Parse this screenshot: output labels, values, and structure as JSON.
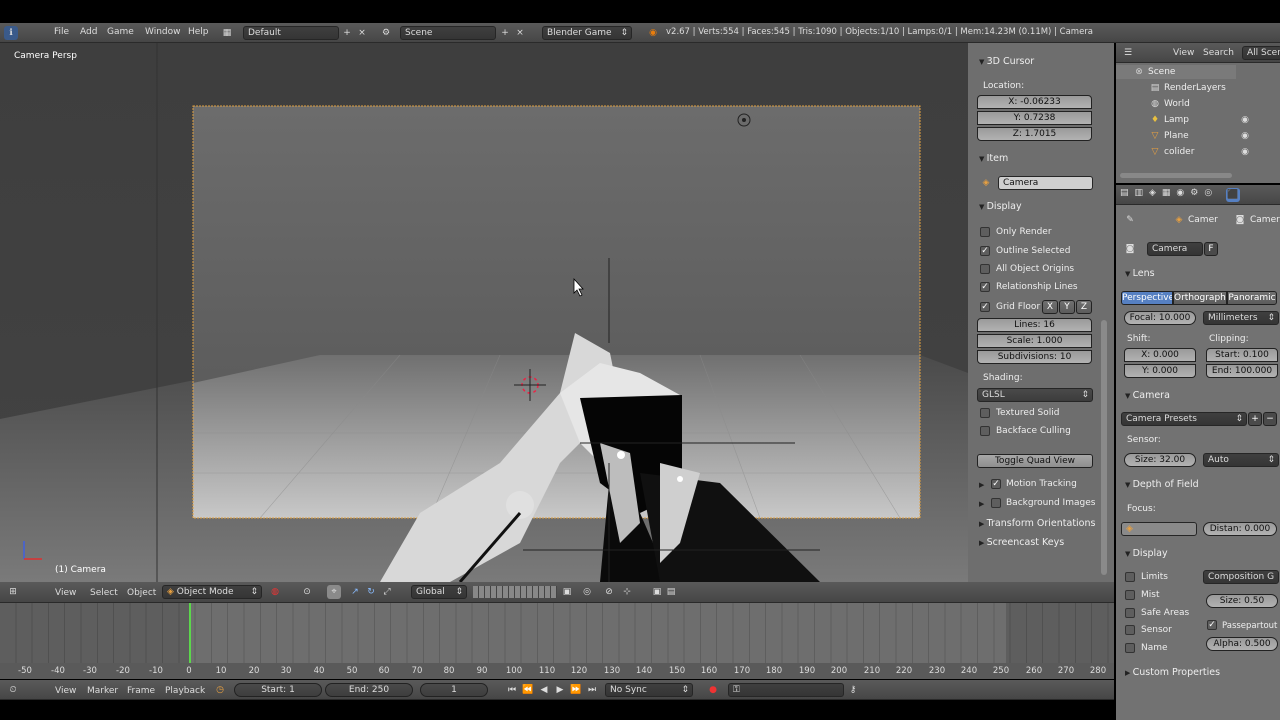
{
  "top_bar": {
    "menus": [
      "File",
      "Add",
      "Game",
      "Window",
      "Help"
    ],
    "layout_screen": "Default",
    "scene": "Scene",
    "engine": "Blender Game",
    "stats": "v2.67 | Verts:554 | Faces:545 | Tris:1090 | Objects:1/10 | Lamps:0/1 | Mem:14.23M (0.11M) | Camera"
  },
  "viewport": {
    "view_name": "Camera Persp",
    "object_label": "(1) Camera"
  },
  "properties_panel": {
    "cursor_header": "3D Cursor",
    "location_label": "Location:",
    "cursor_x": "X: -0.06233",
    "cursor_y": "Y: 0.7238",
    "cursor_z": "Z: 1.7015",
    "item_header": "Item",
    "item_name": "Camera",
    "display_header": "Display",
    "only_render": "Only Render",
    "outline_selected": "Outline Selected",
    "all_object_origins": "All Object Origins",
    "relationship_lines": "Relationship Lines",
    "grid_floor": "Grid Floor",
    "axis_x": "X",
    "axis_y": "Y",
    "axis_z": "Z",
    "lines": "Lines: 16",
    "scale": "Scale: 1.000",
    "subdivisions": "Subdivisions: 10",
    "shading_label": "Shading:",
    "shading_value": "GLSL",
    "textured_solid": "Textured Solid",
    "backface_culling": "Backface Culling",
    "toggle_quad_view": "Toggle Quad View",
    "motion_tracking": "Motion Tracking",
    "background_images": "Background Images",
    "transform_orientations": "Transform Orientations",
    "screencast_keys": "Screencast Keys"
  },
  "outliner": {
    "view": "View",
    "search": "Search",
    "all_scenes": "All Scen",
    "items": [
      "Scene",
      "RenderLayers",
      "World",
      "Lamp",
      "Plane",
      "colider"
    ]
  },
  "camera_props": {
    "breadcrumb_1": "Camer",
    "breadcrumb_2": "Camer",
    "datablock": "Camera",
    "fake_user": "F",
    "lens_header": "Lens",
    "tab_perspective": "Perspective",
    "tab_orthographic": "Orthographic",
    "tab_panoramic": "Panoramic",
    "focal": "Focal: 10.000",
    "units": "Millimeters",
    "shift_label": "Shift:",
    "clipping_label": "Clipping:",
    "shift_x": "X: 0.000",
    "shift_y": "Y: 0.000",
    "clip_start": "Start: 0.100",
    "clip_end": "End: 100.000",
    "camera_header": "Camera",
    "camera_presets": "Camera Presets",
    "sensor_label": "Sensor:",
    "sensor_size": "Size: 32.00",
    "sensor_fit": "Auto",
    "dof_header": "Depth of Field",
    "focus_label": "Focus:",
    "distance": "Distan: 0.000",
    "display_header": "Display",
    "limits": "Limits",
    "composition": "Composition G",
    "mist": "Mist",
    "size": "Size: 0.50",
    "safe_areas": "Safe Areas",
    "passepartout": "Passepartout",
    "sensor": "Sensor",
    "alpha": "Alpha: 0.500",
    "name": "Name",
    "custom_properties": "Custom Properties"
  },
  "view3d_header": {
    "view": "View",
    "select": "Select",
    "object": "Object",
    "mode": "Object Mode",
    "orientation": "Global"
  },
  "timeline": {
    "ticks": [
      "-50",
      "-40",
      "-30",
      "-20",
      "-10",
      "0",
      "10",
      "20",
      "30",
      "40",
      "50",
      "60",
      "70",
      "80",
      "90",
      "100",
      "110",
      "120",
      "130",
      "140",
      "150",
      "160",
      "170",
      "180",
      "190",
      "200",
      "210",
      "220",
      "230",
      "240",
      "250",
      "260",
      "270",
      "280"
    ],
    "view": "View",
    "marker": "Marker",
    "frame": "Frame",
    "playback": "Playback",
    "start": "Start: 1",
    "end": "End: 250",
    "current": "1",
    "sync": "No Sync"
  }
}
